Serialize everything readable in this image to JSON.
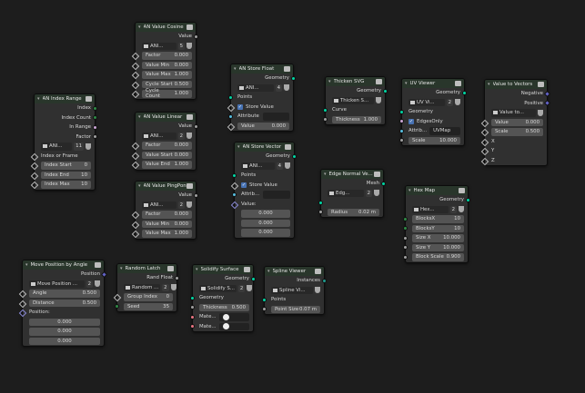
{
  "nodes": {
    "value_cosine": {
      "title": "AN Value Cosine",
      "output": "Value",
      "select_label": "ANI...",
      "select_num": "5",
      "fields": [
        {
          "label": "Factor",
          "value": "0.000"
        },
        {
          "label": "Value Min",
          "value": "0.000"
        },
        {
          "label": "Value Max",
          "value": "1.000"
        },
        {
          "label": "Cycle Start",
          "value": "0.500"
        },
        {
          "label": "Cycle Count",
          "value": "1.000"
        }
      ]
    },
    "value_linear": {
      "title": "AN Value Linear",
      "output": "Value",
      "select_label": "ANI...",
      "select_num": "2",
      "fields": [
        {
          "label": "Factor",
          "value": "0.000"
        },
        {
          "label": "Value Start",
          "value": "0.000"
        },
        {
          "label": "Value End",
          "value": "1.000"
        }
      ]
    },
    "value_pingpong": {
      "title": "AN Value PingPong",
      "output": "Value",
      "select_label": "ANI...",
      "select_num": "2",
      "fields": [
        {
          "label": "Factor",
          "value": "0.000"
        },
        {
          "label": "Value Min",
          "value": "0.000"
        },
        {
          "label": "Value Max",
          "value": "1.000"
        }
      ]
    },
    "index_range": {
      "title": "AN Index Range",
      "outputs": [
        "Index",
        "Index Count",
        "In Range",
        "Factor"
      ],
      "select_label": "ANI...",
      "select_num": "11",
      "input_label": "Index or Frame",
      "fields": [
        {
          "label": "Index Start",
          "value": "0"
        },
        {
          "label": "Index End",
          "value": "10"
        },
        {
          "label": "Index Max",
          "value": "10"
        }
      ]
    },
    "store_float": {
      "title": "AN Store Float",
      "output": "Geometry",
      "select_label": "ANI...",
      "select_num": "4",
      "points": "Points",
      "store_value": "Store Value",
      "attribute": "Attribute",
      "value_label": "Value",
      "value_value": "0.000"
    },
    "store_vector": {
      "title": "AN Store Vector",
      "output": "Geometry",
      "select_label": "ANI...",
      "select_num": "4",
      "points": "Points",
      "store_value": "Store Value",
      "attribute": "Attrib...",
      "value_label": "Value:",
      "values": [
        "0.000",
        "0.000",
        "0.000"
      ]
    },
    "thicken_svg": {
      "title": "Thicken SVG",
      "output": "Geometry",
      "select_label": "Thicken S...",
      "curve": "Curve",
      "thickness_label": "Thickness",
      "thickness_value": "1.000"
    },
    "uv_viewer": {
      "title": "UV Viewer",
      "output": "Geometry",
      "select_label": "UV Vi...",
      "select_num": "2",
      "geometry": "Geometry",
      "edges_only": "EdgesOnly",
      "attrib_label": "Attrib...",
      "attrib_value": "UVMap",
      "scale_label": "Scale",
      "scale_value": "10.000"
    },
    "value_to_vectors": {
      "title": "Value to Vectors",
      "outputs": [
        "Negative",
        "Positive"
      ],
      "select_label": "Value to...",
      "fields": [
        {
          "label": "Value",
          "value": "0.000"
        },
        {
          "label": "Scale",
          "value": "0.500"
        }
      ],
      "axes": [
        "X",
        "Y",
        "Z"
      ]
    },
    "edge_normal": {
      "title": "Edge Normal Ve...",
      "output": "Mesh",
      "select_label": "Edg...",
      "select_num": "2",
      "radius_label": "Radius",
      "radius_value": "0.02 m"
    },
    "hex_map": {
      "title": "Hex Map",
      "output": "Geometry",
      "select_label": "Hex...",
      "select_num": "2",
      "fields": [
        {
          "label": "BlocksX",
          "value": "10"
        },
        {
          "label": "BlocksY",
          "value": "10"
        },
        {
          "label": "Size X",
          "value": "10.000"
        },
        {
          "label": "Size Y",
          "value": "10.000"
        },
        {
          "label": "Block Scale",
          "value": "0.900"
        }
      ]
    },
    "move_position": {
      "title": "Move Position by Angle",
      "output": "Position",
      "select_label": "Move Position ...",
      "select_num": "2",
      "fields": [
        {
          "label": "Angle",
          "value": "0.500"
        },
        {
          "label": "Distance",
          "value": "0.500"
        }
      ],
      "position_label": "Position:",
      "values": [
        "0.000",
        "0.000",
        "0.000"
      ]
    },
    "random_latch": {
      "title": "Random Latch",
      "output": "Rand Float",
      "select_label": "Random ...",
      "select_num": "2",
      "fields": [
        {
          "label": "Group Index",
          "value": "0"
        },
        {
          "label": "Seed",
          "value": "35"
        }
      ]
    },
    "solidify_surface": {
      "title": "Solidify Surface",
      "output": "Geometry",
      "select_label": "Solidify S...",
      "select_num": "2",
      "geometry": "Geometry",
      "thickness_label": "Thickness",
      "thickness_value": "0.500",
      "mate1": "Mate...",
      "mate2": "Mate..."
    },
    "spline_viewer": {
      "title": "Spline Viewer",
      "output": "Instances",
      "select_label": "Spline Vi...",
      "points": "Points",
      "point_size_label": "Point Size",
      "point_size_value": "0.07 m"
    }
  }
}
